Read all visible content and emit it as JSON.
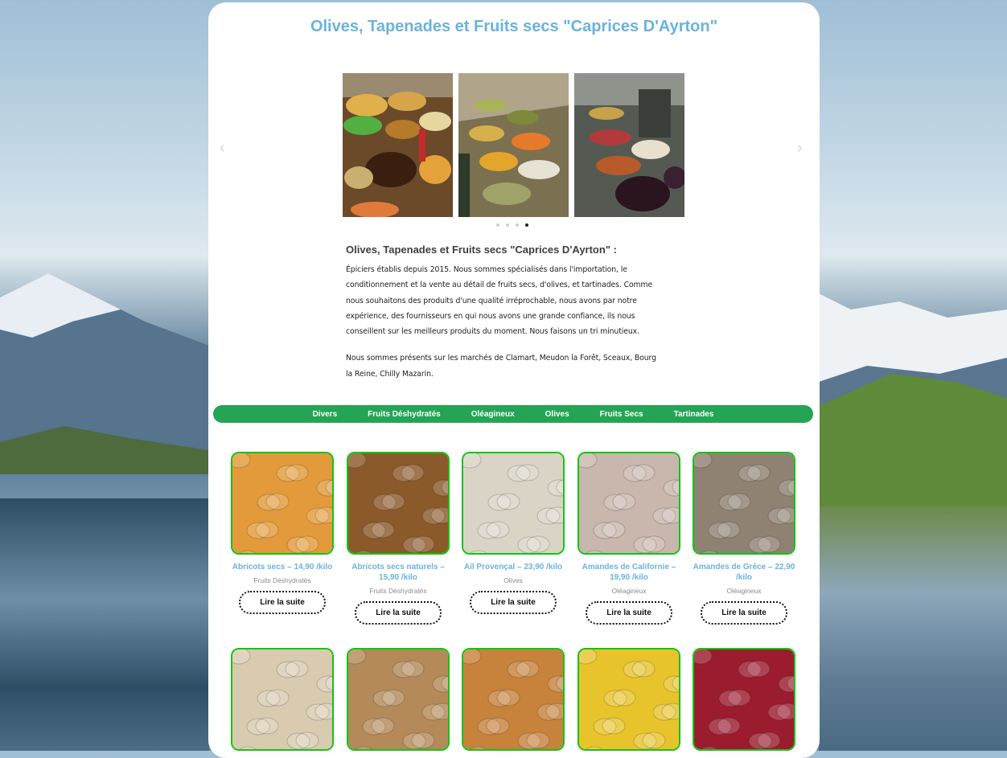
{
  "site_title": "Olives, Tapenades et Fruits secs \"Caprices D'Ayrton\"",
  "carousel": {
    "prev_icon": "‹",
    "next_icon": "›",
    "slides": [
      "slide-1",
      "slide-2",
      "slide-3"
    ],
    "dots_count": 4,
    "active_dot": 4
  },
  "intro": {
    "heading": "Olives, Tapenades et Fruits secs \"Caprices D'Ayrton\" :",
    "paragraph1": "Épiciers établis depuis 2015. Nous sommes spécialisés dans l'importation, le conditionnement et la vente au détail de fruits secs, d'olives, et tartinades. Comme nous souhaitons des produits d'une qualité irréprochable, nous avons par notre expérience, des fournisseurs en qui nous avons une grande confiance, ils nous conseillent sur les meilleurs produits du moment. Nous faisons un tri minutieux.",
    "paragraph2": "Nous sommes présents sur les marchés de Clamart, Meudon la Forêt, Sceaux, Bourg la Reine, Chilly Mazarin."
  },
  "nav": [
    "Divers",
    "Fruits Déshydratés",
    "Oléagineux",
    "Olives",
    "Fruits Secs",
    "Tartinades"
  ],
  "products": [
    {
      "name": "Abricots secs – 14,90 /kilo",
      "category": "Fruits Déshydratés",
      "button": "Lire la suite",
      "color": "#e39a3a"
    },
    {
      "name": "Abricots secs naturels – 15,90 /kilo",
      "category": "Fruits Déshydratés",
      "button": "Lire la suite",
      "color": "#8b5a2b"
    },
    {
      "name": "Ail Provençal – 23,90 /kilo",
      "category": "Olives",
      "button": "Lire la suite",
      "color": "#d9d4c6"
    },
    {
      "name": "Amandes de Californie – 19,90 /kilo",
      "category": "Oléagineux",
      "button": "Lire la suite",
      "color": "#c9b6ad"
    },
    {
      "name": "Amandes de Grèce – 22,90 /kilo",
      "category": "Oléagineux",
      "button": "Lire la suite",
      "color": "#8f8272"
    },
    {
      "name": "",
      "category": "",
      "button": "",
      "color": "#d8cbb0"
    },
    {
      "name": "",
      "category": "",
      "button": "",
      "color": "#b48a5a"
    },
    {
      "name": "",
      "category": "",
      "button": "",
      "color": "#c7823c"
    },
    {
      "name": "",
      "category": "",
      "button": "",
      "color": "#e8c42c"
    },
    {
      "name": "",
      "category": "",
      "button": "",
      "color": "#9b1c2e"
    }
  ],
  "button_label": "Lire la suite"
}
